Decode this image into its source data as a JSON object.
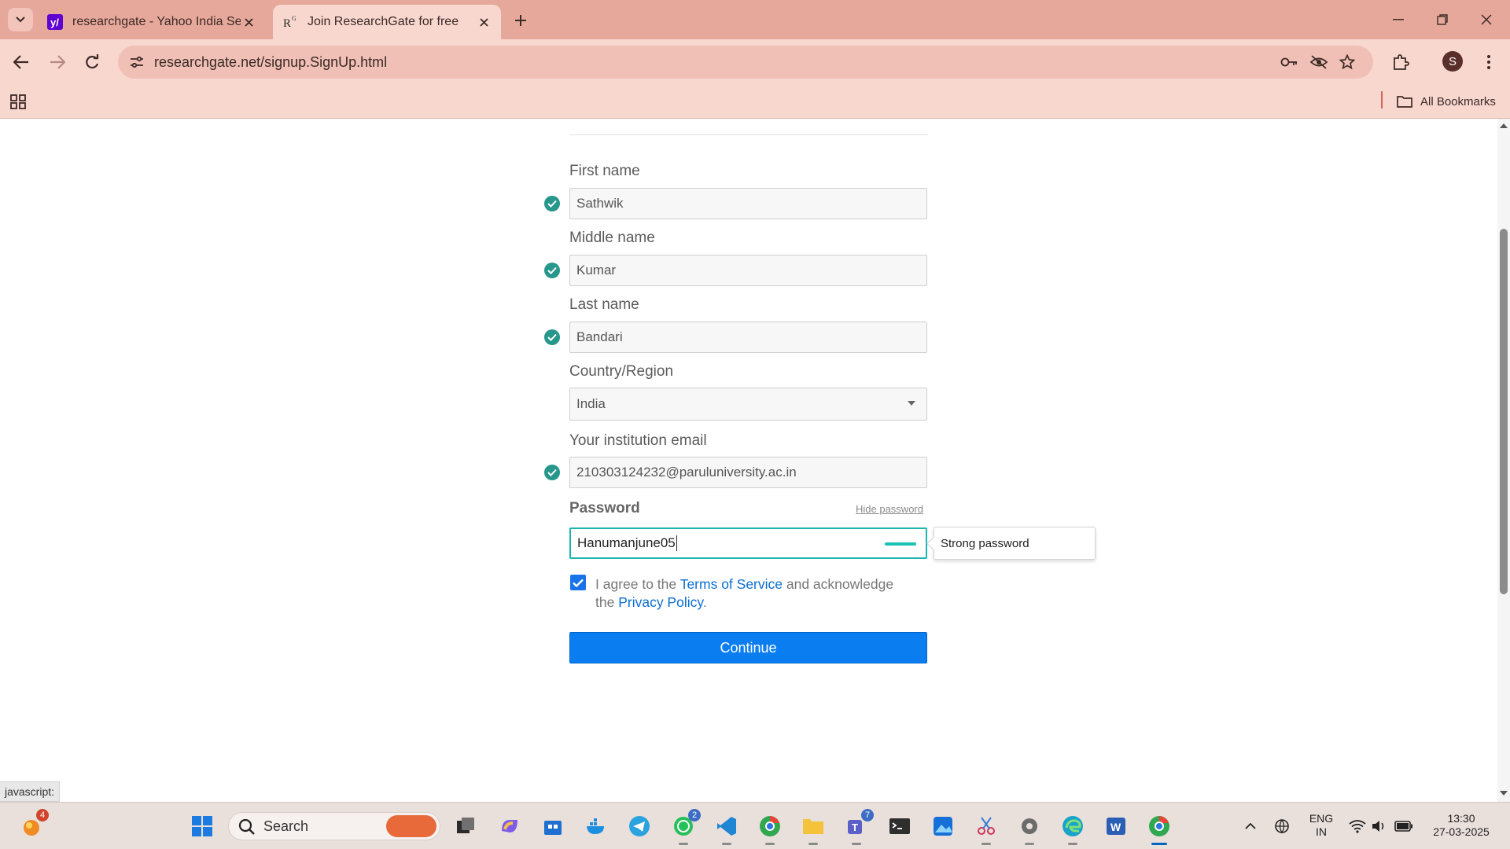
{
  "browser": {
    "tabs": [
      {
        "title": "researchgate - Yahoo India Sear",
        "favicon": "yahoo-icon",
        "active": false
      },
      {
        "title": "Join ResearchGate for free",
        "favicon": "researchgate-icon",
        "active": true
      }
    ],
    "url": "researchgate.net/signup.SignUp.html",
    "profile_initial": "S",
    "bookmarks_label": "All Bookmarks",
    "status_text": "javascript:"
  },
  "form": {
    "first_name": {
      "label": "First name",
      "value": "Sathwik"
    },
    "middle_name": {
      "label": "Middle name",
      "value": "Kumar"
    },
    "last_name": {
      "label": "Last name",
      "value": "Bandari"
    },
    "country": {
      "label": "Country/Region",
      "value": "India"
    },
    "email": {
      "label": "Your institution email",
      "value": "210303124232@paruluniversity.ac.in"
    },
    "password": {
      "label": "Password",
      "value": "Hanumanjune05",
      "hide_label": "Hide password",
      "strength": "Strong password"
    },
    "agree": {
      "checked": true,
      "prefix": "I agree to the ",
      "terms": "Terms of Service",
      "middle": " and acknowledge the ",
      "privacy": "Privacy Policy",
      "suffix": "."
    },
    "continue_label": "Continue"
  },
  "taskbar": {
    "search_label": "Search",
    "badges": {
      "notifications": "4",
      "whatsapp": "2",
      "teams": "7"
    },
    "language": "ENG",
    "region": "IN",
    "time": "13:30",
    "date": "27-03-2025"
  },
  "colors": {
    "accent": "#0a7df0",
    "valid": "#27978c",
    "chrome": "#e6a89b",
    "strength": "#18c2b5"
  }
}
